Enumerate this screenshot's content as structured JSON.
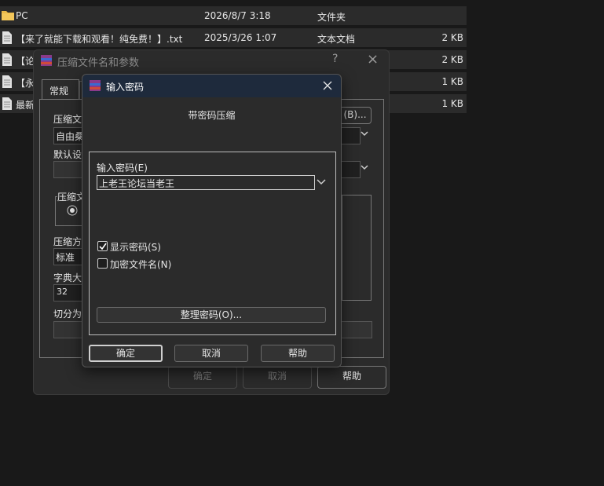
{
  "explorer": {
    "files": [
      {
        "name": "PC",
        "date": "2026/8/7 3:18",
        "type": "文件夹",
        "size": "",
        "icon": "folder-icon"
      },
      {
        "name": "【来了就能下载和观看！纯免费！】.txt",
        "date": "2025/3/26 1:07",
        "type": "文本文档",
        "size": "2 KB",
        "icon": "text-file-icon"
      },
      {
        "name": "【论",
        "date": "",
        "type": "",
        "size": "2 KB",
        "icon": "text-file-icon"
      },
      {
        "name": "【永",
        "date": "",
        "type": "",
        "size": "1 KB",
        "icon": "text-file-icon"
      },
      {
        "name": "最新",
        "date": "",
        "type": "",
        "size": "1 KB",
        "icon": "text-file-icon"
      }
    ]
  },
  "archive_dialog": {
    "title": "压缩文件名和参数",
    "help_glyph": "?",
    "close_glyph": "×",
    "tab_general": "常规",
    "archive_name_label": "压缩文",
    "archive_name_value": "自由桑",
    "browse_button": "(B)...",
    "default_profile_label": "默认设",
    "format_group_label": "压缩文",
    "method_label": "压缩方",
    "method_value": "标准",
    "dict_label": "字典大",
    "dict_value": "32",
    "split_label": "切分为",
    "ok_button": "确定",
    "cancel_button": "取消",
    "help_button": "帮助"
  },
  "password_dialog": {
    "title": "输入密码",
    "heading": "带密码压缩",
    "password_label": "输入密码(E)",
    "password_value": "上老王论坛当老王",
    "show_password_label": "显示密码(S)",
    "show_password_checked": true,
    "encrypt_names_label": "加密文件名(N)",
    "encrypt_names_checked": false,
    "organize_button": "整理密码(O)...",
    "ok_button": "确定",
    "cancel_button": "取消",
    "help_button": "帮助"
  },
  "colors": {
    "background": "#191919",
    "row": "#2b2b2b",
    "dialog": "#2b2b2b",
    "title_bar": "#1e2a3c",
    "folder": "#e8b84a"
  }
}
